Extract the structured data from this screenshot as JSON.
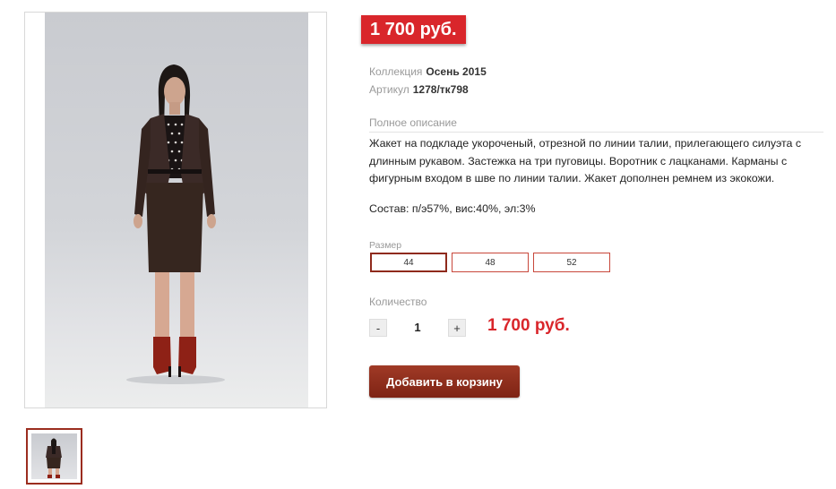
{
  "product": {
    "price_badge": "1 700 руб.",
    "collection_label": "Коллекция",
    "collection_value": "Осень 2015",
    "article_label": "Артикул",
    "article_value": "1278/тк798",
    "description_label": "Полное описание",
    "description_text": "Жакет на подкладе укороченый, отрезной по линии талии, прилегающего силуэта с длинным рукавом. Застежка на три пуговицы. Воротник  с лацканами. Карманы с фигурным входом в шве по линии талии. Жакет дополнен ремнем из экокожи.",
    "composition": "Состав: п/э57%, вис:40%, эл:3%"
  },
  "sizes": {
    "label": "Размер",
    "options": [
      "44",
      "48",
      "52"
    ],
    "selected": "44"
  },
  "quantity": {
    "label": "Количество",
    "minus_label": "-",
    "value": "1",
    "plus_label": "+",
    "total_price": "1 700 руб."
  },
  "cart": {
    "add_label": "Добавить в корзину"
  },
  "colors": {
    "accent_red": "#d9262b",
    "button_dark_red": "#8f2a1c"
  }
}
